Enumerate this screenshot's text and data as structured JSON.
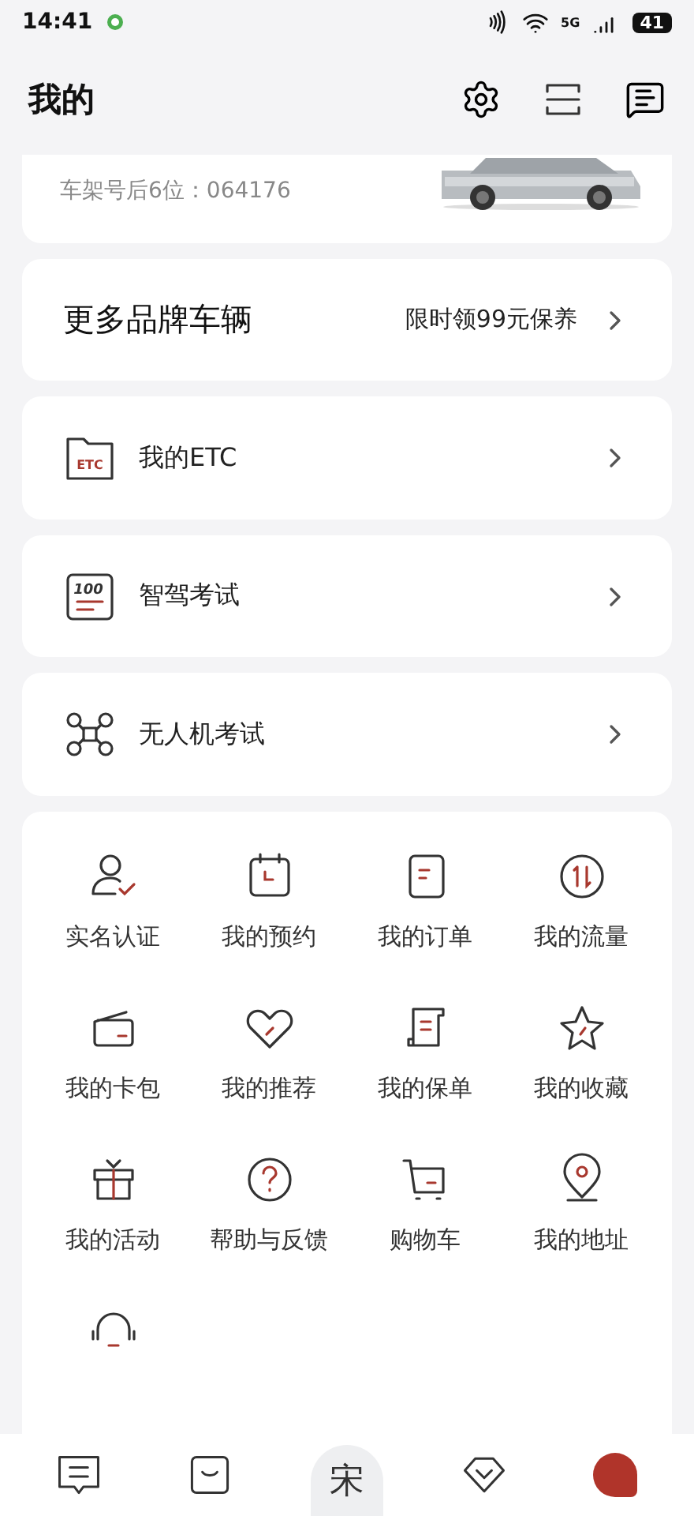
{
  "status_bar": {
    "time": "14:41",
    "network": "5G",
    "battery": "41"
  },
  "header": {
    "title": "我的"
  },
  "vehicle": {
    "vin": "车架号后6位：064176"
  },
  "brand_card": {
    "title": "更多品牌车辆",
    "promo": "限时领99元保养"
  },
  "services": [
    {
      "label": "我的ETC",
      "icon_text": "ETC"
    },
    {
      "label": "智驾考试",
      "icon_text": "100"
    },
    {
      "label": "无人机考试"
    }
  ],
  "grid": [
    {
      "label": "实名认证"
    },
    {
      "label": "我的预约"
    },
    {
      "label": "我的订单"
    },
    {
      "label": "我的流量"
    },
    {
      "label": "我的卡包"
    },
    {
      "label": "我的推荐"
    },
    {
      "label": "我的保单"
    },
    {
      "label": "我的收藏"
    },
    {
      "label": "我的活动"
    },
    {
      "label": "帮助与反馈"
    },
    {
      "label": "购物车"
    },
    {
      "label": "我的地址"
    }
  ],
  "bottom_nav": [
    {
      "kind": "icon",
      "selected": false
    },
    {
      "kind": "icon",
      "selected": false
    },
    {
      "kind": "logo",
      "text": "宋",
      "selected": false
    },
    {
      "kind": "icon",
      "selected": false
    },
    {
      "kind": "avatar",
      "selected": true
    }
  ]
}
